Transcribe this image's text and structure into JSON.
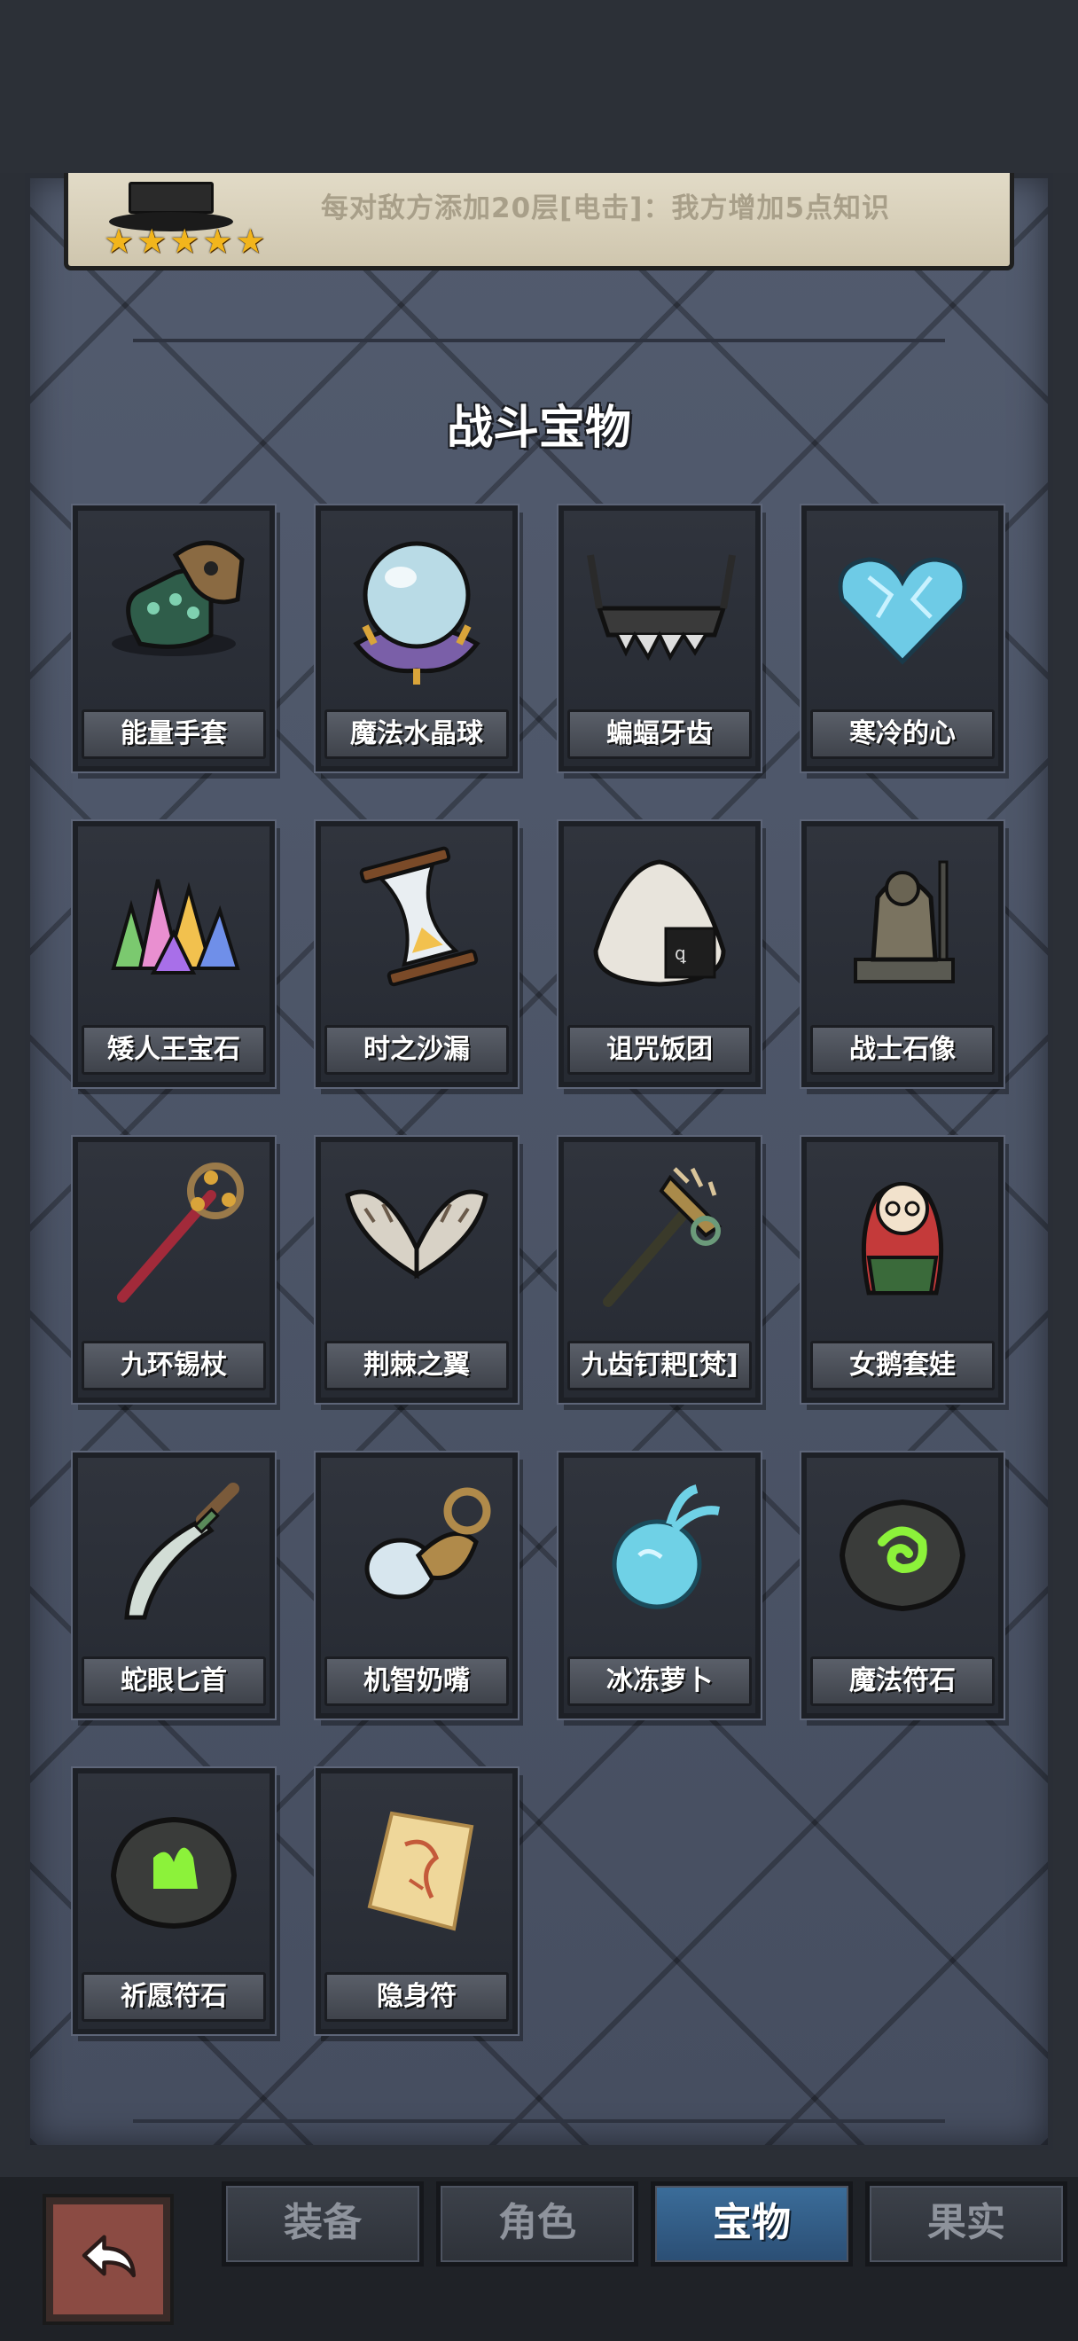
{
  "top_info": {
    "stars": 5,
    "effect_text": "每对敌方添加20层[电击]：我方增加5点知识"
  },
  "section_title": "战斗宝物",
  "items": [
    {
      "label": "能量手套",
      "icon": "glove-icon"
    },
    {
      "label": "魔法水晶球",
      "icon": "crystal-ball-icon"
    },
    {
      "label": "蝙蝠牙齿",
      "icon": "bat-teeth-icon"
    },
    {
      "label": "寒冷的心",
      "icon": "ice-heart-icon"
    },
    {
      "label": "矮人王宝石",
      "icon": "gem-cluster-icon"
    },
    {
      "label": "时之沙漏",
      "icon": "hourglass-icon"
    },
    {
      "label": "诅咒饭团",
      "icon": "rice-ball-icon"
    },
    {
      "label": "战士石像",
      "icon": "warrior-statue-icon"
    },
    {
      "label": "九环锡杖",
      "icon": "staff-icon"
    },
    {
      "label": "荆棘之翼",
      "icon": "thorn-wings-icon"
    },
    {
      "label": "九齿钉耙[梵]",
      "icon": "rake-icon"
    },
    {
      "label": "女鹅套娃",
      "icon": "nesting-doll-icon"
    },
    {
      "label": "蛇眼匕首",
      "icon": "dagger-icon"
    },
    {
      "label": "机智奶嘴",
      "icon": "pacifier-icon"
    },
    {
      "label": "冰冻萝卜",
      "icon": "frozen-radish-icon"
    },
    {
      "label": "魔法符石",
      "icon": "rune-stone-icon"
    },
    {
      "label": "祈愿符石",
      "icon": "wish-stone-icon"
    },
    {
      "label": "隐身符",
      "icon": "talisman-icon"
    }
  ],
  "tabs": [
    {
      "label": "装备",
      "active": false
    },
    {
      "label": "角色",
      "active": false
    },
    {
      "label": "宝物",
      "active": true
    },
    {
      "label": "果实",
      "active": false
    }
  ]
}
